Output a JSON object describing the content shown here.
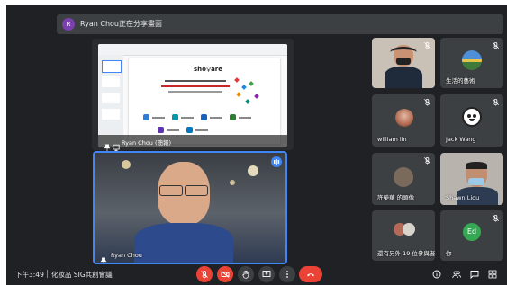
{
  "presenter_bar": {
    "avatar_letter": "R",
    "text": "Ryan Chou正在分享畫面"
  },
  "main": {
    "share_label": "Ryan Chou (簡報)",
    "video_label": "Ryan Chou"
  },
  "slide": {
    "brand": "sho♀are"
  },
  "participants": [
    {
      "name": ""
    },
    {
      "name": "生活的藝術"
    },
    {
      "name": "william lin"
    },
    {
      "name": "Jack Wang"
    },
    {
      "name": "許榮華 的頭像"
    },
    {
      "name": "Shawn Liou"
    },
    {
      "name": "還有另外 19 位參與者"
    },
    {
      "name": "你",
      "avatar_letter": "Ed"
    }
  ],
  "bottom_bar": {
    "time": "下午3:49",
    "meeting_name": "化妝品 SIG共創會議"
  },
  "colors": {
    "background": "#202124",
    "tile": "#3c4043",
    "active_speaker_border": "#4285f4",
    "end_call": "#ea4335",
    "muted_button": "#ea4335",
    "avatar_green": "#34a853"
  },
  "icons": {
    "mic_off": "mic-off-icon",
    "camera_off": "camera-off-icon",
    "raise_hand": "raise-hand-icon",
    "present": "present-icon",
    "more": "more-options-icon",
    "end_call": "end-call-icon",
    "info": "info-icon",
    "people": "people-icon",
    "chat": "chat-icon",
    "activities": "activities-icon"
  }
}
